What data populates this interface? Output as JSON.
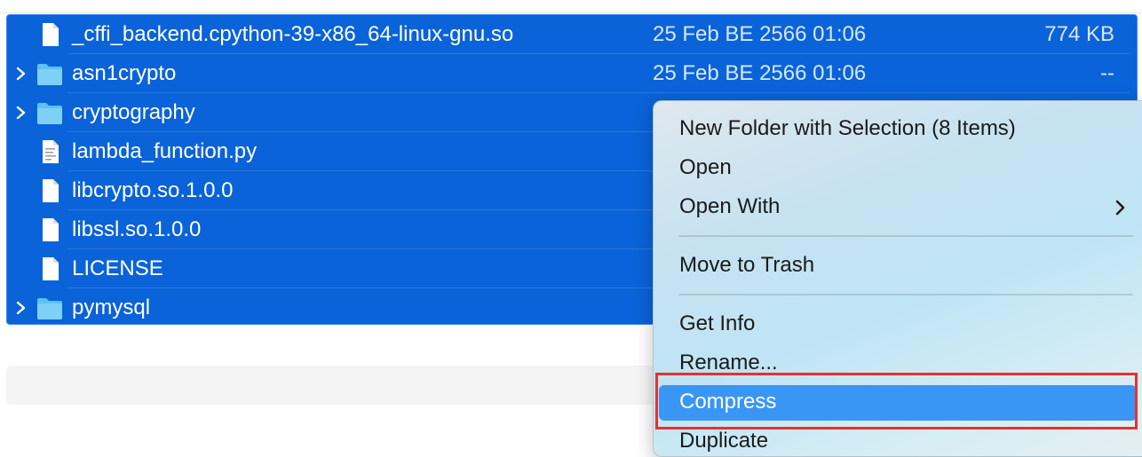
{
  "file_list": {
    "rows": [
      {
        "name": "_cffi_backend.cpython-39-x86_64-linux-gnu.so",
        "date": "25 Feb BE 2566 01:06",
        "size": "774 KB",
        "kind": "file",
        "icon": "document-icon"
      },
      {
        "name": "asn1crypto",
        "date": "25 Feb BE 2566 01:06",
        "size": "--",
        "kind": "folder",
        "icon": "folder-icon"
      },
      {
        "name": "cryptography",
        "kind": "folder",
        "icon": "folder-icon"
      },
      {
        "name": "lambda_function.py",
        "kind": "python",
        "icon": "python-script-icon"
      },
      {
        "name": "libcrypto.so.1.0.0",
        "kind": "file",
        "icon": "document-icon"
      },
      {
        "name": "libssl.so.1.0.0",
        "kind": "file",
        "icon": "document-icon"
      },
      {
        "name": "LICENSE",
        "kind": "file",
        "icon": "document-icon"
      },
      {
        "name": "pymysql",
        "kind": "folder",
        "icon": "folder-icon"
      }
    ],
    "selection_color": "#0a63d8"
  },
  "context_menu": {
    "items": [
      {
        "label": "New Folder with Selection (8 Items)"
      },
      {
        "label": "Open"
      },
      {
        "label": "Open With",
        "submenu": true
      },
      {
        "label": "Move to Trash"
      },
      {
        "label": "Get Info"
      },
      {
        "label": "Rename..."
      },
      {
        "label": "Compress",
        "highlighted": true
      },
      {
        "label": "Duplicate"
      }
    ],
    "highlight_color": "#3996f5",
    "annotation_color": "#e5322d"
  }
}
